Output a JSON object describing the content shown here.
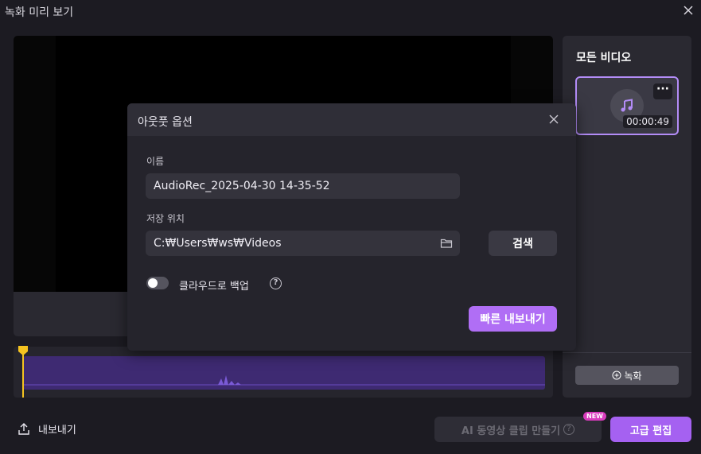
{
  "window": {
    "title": "녹화 미리 보기"
  },
  "right_panel": {
    "title": "모든 비디오",
    "clip": {
      "duration": "00:00:49",
      "more_label": "···"
    },
    "record_button": "녹화"
  },
  "bottom_bar": {
    "export_label": "내보내기",
    "ai_button": "AI 동영상 클립 만들기",
    "ai_badge": "NEW",
    "advanced_edit": "고급 편집"
  },
  "dialog": {
    "title": "아웃풋 옵션",
    "name_label": "이름",
    "name_value": "AudioRec_2025-04-30 14-35-52",
    "location_label": "저장 위치",
    "location_value": "C:₩Users₩ws₩Videos",
    "browse_button": "검색",
    "cloud_backup_label": "클라우드로 백업",
    "cloud_backup_enabled": false,
    "quick_export_button": "빠른 내보내기"
  },
  "colors": {
    "accent": "#a561f1",
    "playhead": "#f5c320",
    "waveform": "#3e2a72"
  }
}
